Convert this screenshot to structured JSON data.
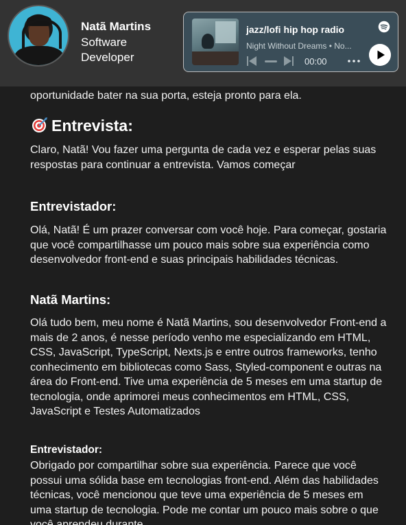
{
  "profile": {
    "name": "Natã Martins",
    "role": "Software Developer"
  },
  "player": {
    "title": "jazz/lofi hip hop radio",
    "subtitle": "Night Without Dreams • No...",
    "time": "00:00",
    "icons": {
      "logo": "spotify-icon",
      "prev": "skip-previous-icon",
      "next": "skip-next-icon",
      "more": "more-dots-icon",
      "play": "play-icon"
    }
  },
  "article": {
    "intro_tail": "oportunidade bater na sua porta, esteja pronto para ela.",
    "section_icon": "dart-target-icon",
    "section_title": "Entrevista:",
    "prompt_text": "Claro, Natã! Vou fazer uma pergunta de cada vez e esperar pelas suas respostas para continuar a entrevista. Vamos começar",
    "turns": [
      {
        "speaker": "Entrevistador:",
        "text": "Olá, Natã! É um prazer conversar com você hoje. Para começar, gostaria que você compartilhasse um pouco mais sobre sua experiência como desenvolvedor front-end e suas principais habilidades técnicas."
      },
      {
        "speaker": "Natã Martins:",
        "text": "Olá tudo bem, meu nome é Natã Martins, sou desenvolvedor Front-end a mais de 2 anos, é nesse período venho me especializando em HTML, CSS, JavaScript, TypeScript, Nexts.js e entre outros frameworks, tenho conhecimento em bibliotecas como Sass, Styled-component e outras na área do Front-end. Tive uma experiência de 5 meses em uma startup de tecnologia, onde aprimorei meus conhecimentos em HTML, CSS, JavaScript e Testes Automatizados"
      },
      {
        "speaker": "Entrevistador:",
        "text": "Obrigado por compartilhar sobre sua experiência. Parece que você possui uma sólida base em tecnologias front-end. Além das habilidades técnicas, você mencionou que teve uma experiência de 5 meses em uma startup de tecnologia. Pode me contar um pouco mais sobre o que você aprendeu durante"
      }
    ]
  },
  "colors": {
    "page_bg": "#1e1e1e",
    "header_bg": "#333333",
    "player_bg": "#3a4d58",
    "text": "#f2f2f2"
  }
}
